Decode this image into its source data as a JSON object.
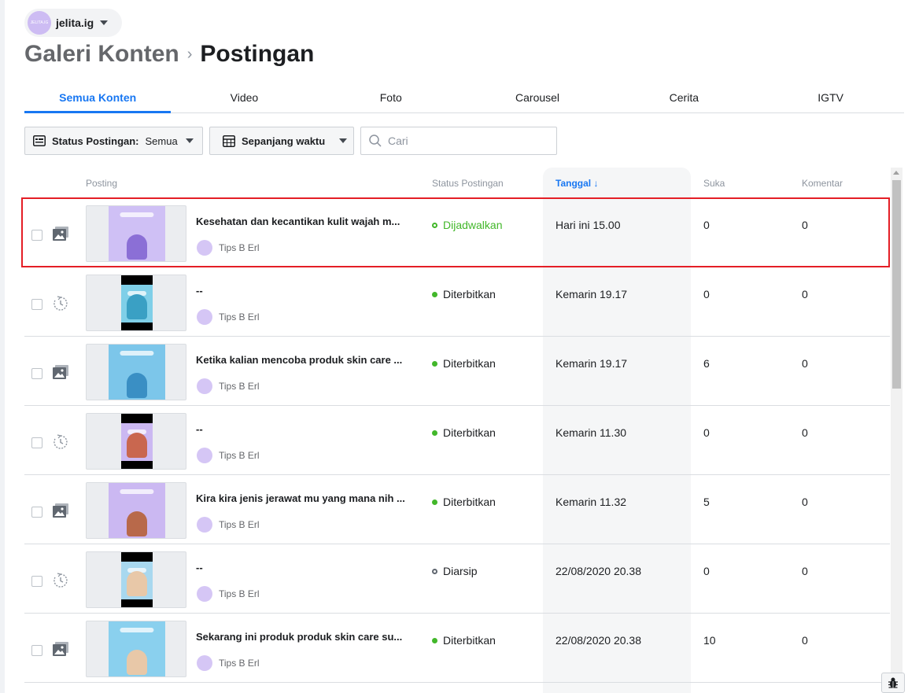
{
  "account": {
    "name": "jelita.ig",
    "avatar_text": "JELITA.IG"
  },
  "breadcrumb": {
    "parent": "Galeri Konten",
    "separator": "›",
    "current": "Postingan"
  },
  "tabs": [
    {
      "label": "Semua Konten",
      "active": true
    },
    {
      "label": "Video",
      "active": false
    },
    {
      "label": "Foto",
      "active": false
    },
    {
      "label": "Carousel",
      "active": false
    },
    {
      "label": "Cerita",
      "active": false
    },
    {
      "label": "IGTV",
      "active": false
    }
  ],
  "filters": {
    "status_label": "Status Postingan:",
    "status_value": "Semua",
    "time_label": "Sepanjang waktu",
    "search_placeholder": "Cari"
  },
  "table": {
    "headers": {
      "post": "Posting",
      "status": "Status Postingan",
      "date": "Tanggal ↓",
      "likes": "Suka",
      "comments": "Komentar"
    },
    "rows": [
      {
        "type": "photo-icon",
        "thumb": "square",
        "thumb_color": "#cfc0f5",
        "fig_color": "#8b6fd6",
        "title": "Kesehatan dan kecantikan kulit wajah m...",
        "author": "Tips B Erl",
        "status": "Dijadwalkan",
        "status_style": "scheduled",
        "date": "Hari ini 15.00",
        "likes": "0",
        "comments": "0"
      },
      {
        "type": "story-icon",
        "thumb": "story",
        "thumb_color": "#7fcfe8",
        "fig_color": "#3aa0c4",
        "title": "--",
        "author": "Tips B Erl",
        "status": "Diterbitkan",
        "status_style": "published",
        "date": "Kemarin 19.17",
        "likes": "0",
        "comments": "0"
      },
      {
        "type": "photo-icon",
        "thumb": "square",
        "thumb_color": "#7cc6ea",
        "fig_color": "#3a8fc4",
        "title": "Ketika kalian mencoba produk skin care ...",
        "author": "Tips B Erl",
        "status": "Diterbitkan",
        "status_style": "published",
        "date": "Kemarin 19.17",
        "likes": "6",
        "comments": "0"
      },
      {
        "type": "story-icon",
        "thumb": "story",
        "thumb_color": "#cbb8f2",
        "fig_color": "#c9674f",
        "title": "--",
        "author": "Tips B Erl",
        "status": "Diterbitkan",
        "status_style": "published",
        "date": "Kemarin 11.30",
        "likes": "0",
        "comments": "0"
      },
      {
        "type": "photo-icon",
        "thumb": "square",
        "thumb_color": "#cbb8f2",
        "fig_color": "#b8694a",
        "title": "Kira kira jenis jerawat mu yang mana nih ...",
        "author": "Tips B Erl",
        "status": "Diterbitkan",
        "status_style": "published",
        "date": "Kemarin 11.32",
        "likes": "5",
        "comments": "0"
      },
      {
        "type": "story-icon",
        "thumb": "story",
        "thumb_color": "#a8d8ef",
        "fig_color": "#e8c8a8",
        "title": "--",
        "author": "Tips B Erl",
        "status": "Diarsip",
        "status_style": "archived",
        "date": "22/08/2020 20.38",
        "likes": "0",
        "comments": "0"
      },
      {
        "type": "photo-icon",
        "thumb": "square",
        "thumb_color": "#8ad0ee",
        "fig_color": "#e8c8a8",
        "title": "Sekarang ini produk produk skin care su...",
        "author": "Tips B Erl",
        "status": "Diterbitkan",
        "status_style": "published",
        "date": "22/08/2020 20.38",
        "likes": "10",
        "comments": "0"
      }
    ]
  },
  "colors": {
    "accent": "#1877f2",
    "published": "#42b72a",
    "highlight": "#e41e26"
  }
}
